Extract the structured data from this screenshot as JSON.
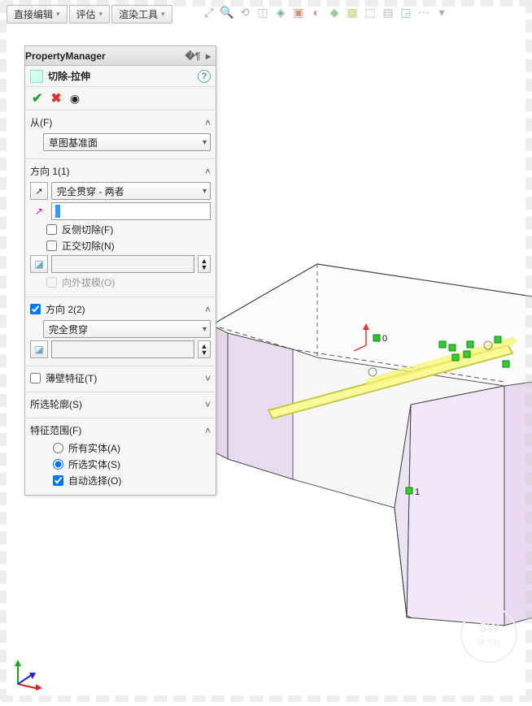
{
  "menubar": {
    "items": [
      "直接编辑",
      "评估",
      "渲染工具"
    ]
  },
  "toolbar_icons": [
    "t1",
    "t2",
    "t3",
    "t4",
    "t5",
    "t6",
    "t7",
    "t8",
    "t9",
    "t10",
    "t11",
    "t12",
    "t13",
    "t14"
  ],
  "pm": {
    "header": "PropertyManager",
    "feature_name": "切除-拉伸",
    "from": {
      "title": "从(F)",
      "start_condition": "草图基准面"
    },
    "dir1": {
      "title": "方向 1(1)",
      "end_condition": "完全贯穿 - 两者",
      "flip_side": "反侧切除(F)",
      "normal_cut": "正交切除(N)",
      "draft_outward": "向外拔模(O)",
      "depth": "",
      "draft": ""
    },
    "dir2": {
      "title": "方向 2(2)",
      "end_condition": "完全贯穿",
      "draft": ""
    },
    "thin": {
      "title": "薄壁特征(T)"
    },
    "contours": {
      "title": "所选轮廓(S)"
    },
    "scope": {
      "title": "特征范围(F)",
      "all_bodies": "所有实体(A)",
      "selected_bodies": "所选实体(S)",
      "auto_select": "自动选择(O)"
    }
  },
  "watermark": {
    "top": "SW",
    "bottom": "研习社"
  },
  "origin_label": "0",
  "dimension_label": "1"
}
